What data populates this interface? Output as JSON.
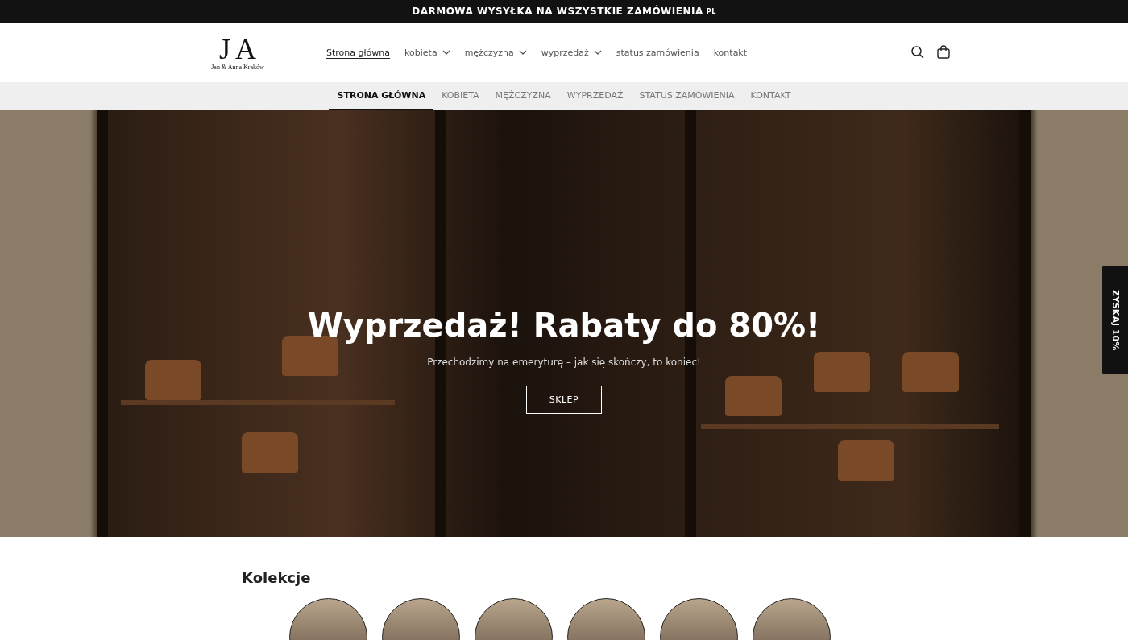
{
  "announcement": {
    "text": "DARMOWA WYSYŁKA NA WSZYSTKIE ZAMÓWIENIA",
    "suffix": "PL"
  },
  "logo": {
    "letter_1": "J",
    "letter_2": "A",
    "name": "Jan & Anna Kraków"
  },
  "main_nav": [
    {
      "label": "Strona główna",
      "selected": true,
      "has_dropdown": false
    },
    {
      "label": "kobieta",
      "selected": false,
      "has_dropdown": true
    },
    {
      "label": "mężczyzna",
      "selected": false,
      "has_dropdown": true
    },
    {
      "label": "wyprzedaż",
      "selected": false,
      "has_dropdown": true
    },
    {
      "label": "status zamówienia",
      "selected": false,
      "has_dropdown": false
    },
    {
      "label": "kontakt",
      "selected": false,
      "has_dropdown": false
    }
  ],
  "sub_nav": [
    {
      "label": "STRONA GŁÓWNA",
      "selected": true
    },
    {
      "label": "KOBIETA",
      "selected": false
    },
    {
      "label": "MĘŻCZYZNA",
      "selected": false
    },
    {
      "label": "WYPRZEDAŻ",
      "selected": false
    },
    {
      "label": "STATUS ZAMÓWIENIA",
      "selected": false
    },
    {
      "label": "KONTAKT",
      "selected": false
    }
  ],
  "hero": {
    "title": "Wyprzedaż! Rabaty do 80%!",
    "subtitle": "Przechodzimy na emeryturę – jak się skończy, to koniec!",
    "button": "SKLEP"
  },
  "side_tab": {
    "label": "ZYSKAJ 10%"
  },
  "collections": {
    "title": "Kolekcje"
  }
}
